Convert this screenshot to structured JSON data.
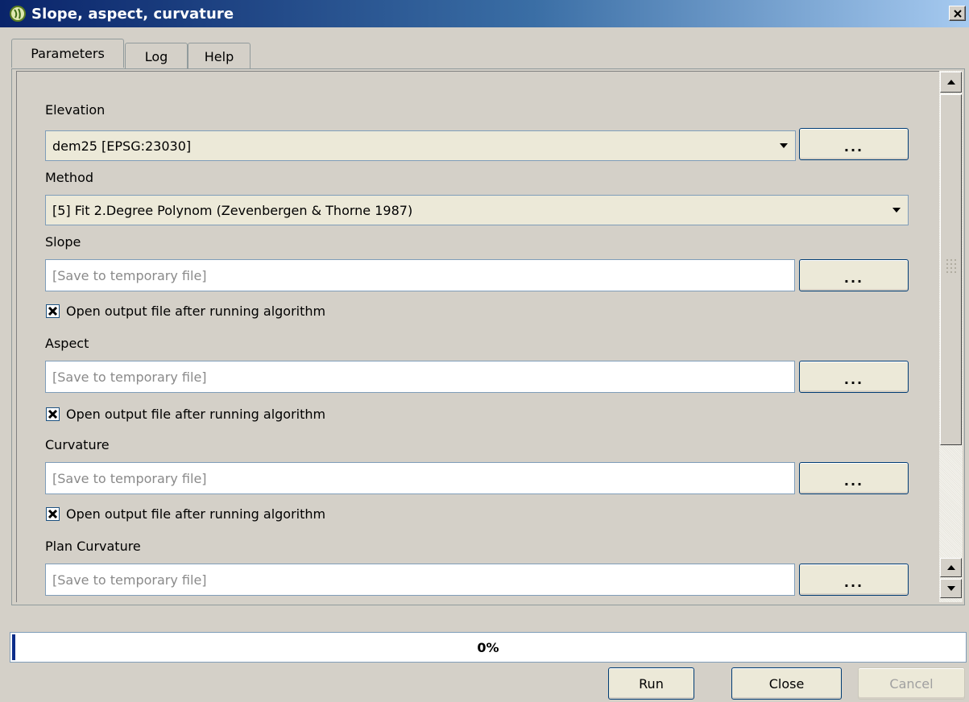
{
  "window": {
    "title": "Slope, aspect, curvature"
  },
  "tabs": [
    {
      "label": "Parameters",
      "active": true
    },
    {
      "label": "Log",
      "active": false
    },
    {
      "label": "Help",
      "active": false
    }
  ],
  "params": {
    "elevation": {
      "label": "Elevation",
      "value": "dem25 [EPSG:23030]",
      "browse": "..."
    },
    "method": {
      "label": "Method",
      "value": "[5] Fit 2.Degree Polynom (Zevenbergen & Thorne 1987)"
    },
    "slope": {
      "label": "Slope",
      "placeholder": "[Save to temporary file]",
      "browse": "...",
      "open_after": "Open output file after running algorithm",
      "checked": true
    },
    "aspect": {
      "label": "Aspect",
      "placeholder": "[Save to temporary file]",
      "browse": "...",
      "open_after": "Open output file after running algorithm",
      "checked": true
    },
    "curvature": {
      "label": "Curvature",
      "placeholder": "[Save to temporary file]",
      "browse": "...",
      "open_after": "Open output file after running algorithm",
      "checked": true
    },
    "plan_curvature": {
      "label": "Plan Curvature",
      "placeholder": "[Save to temporary file]",
      "browse": "..."
    }
  },
  "progress": {
    "value": 0,
    "text": "0%"
  },
  "buttons": {
    "run": "Run",
    "close": "Close",
    "cancel": "Cancel"
  },
  "icons": {
    "app": "qgis-logo-icon",
    "close": "close-icon"
  },
  "colors": {
    "title_start": "#0a246a",
    "title_end": "#a6caf0",
    "progress_fill": "#0c2d8a"
  }
}
